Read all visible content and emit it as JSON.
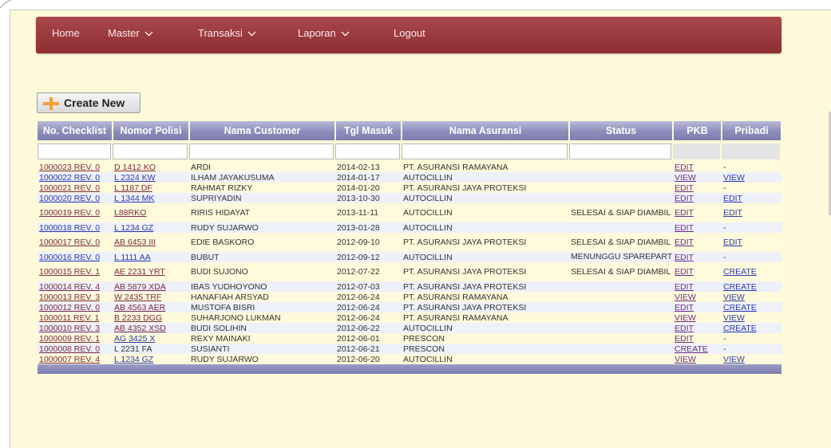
{
  "nav": {
    "items": [
      {
        "label": "Home",
        "dropdown": false
      },
      {
        "label": "Master",
        "dropdown": true
      },
      {
        "label": "Transaksi",
        "dropdown": true
      },
      {
        "label": "Laporan",
        "dropdown": true
      },
      {
        "label": "Logout",
        "dropdown": false
      }
    ]
  },
  "create_button": {
    "label": "Create New",
    "icon": "plus-icon"
  },
  "table": {
    "headers": [
      "No. Checklist",
      "Nomor Polisi",
      "Nama Customer",
      "Tgl Masuk",
      "Nama Asuransi",
      "Status",
      "PKB",
      "Pribadi"
    ],
    "rows": [
      {
        "checklist": "1000023 REV. 0",
        "polisi": "D 1412 KO",
        "customer": "ARDI",
        "tgl": "2014-02-13",
        "asuransi": "PT. ASURANSI RAMAYANA",
        "status": "",
        "pkb": "EDIT",
        "pribadi": "-"
      },
      {
        "checklist": "1000022 REV. 0",
        "polisi": "L 2324 KW",
        "customer": "ILHAM JAYAKUSUMA",
        "tgl": "2014-01-17",
        "asuransi": "AUTOCILLIN",
        "status": "",
        "pkb": "VIEW",
        "pribadi": "VIEW"
      },
      {
        "checklist": "1000021 REV. 0",
        "polisi": "L 1187 DF",
        "customer": "RAHMAT RIZKY",
        "tgl": "2014-01-20",
        "asuransi": "PT. ASURANSI JAYA PROTEKSI",
        "status": "",
        "pkb": "EDIT",
        "pribadi": "-"
      },
      {
        "checklist": "1000020 REV. 0",
        "polisi": "L 1344 MK",
        "customer": "SUPRIYADIN",
        "tgl": "2013-10-30",
        "asuransi": "AUTOCILLIN",
        "status": "",
        "pkb": "EDIT",
        "pribadi": "EDIT"
      },
      {
        "checklist": "1000019 REV. 0",
        "polisi": "L88RKO",
        "customer": "RIRIS HIDAYAT",
        "tgl": "2013-11-11",
        "asuransi": "AUTOCILLIN",
        "status": "SELESAI & SIAP DIAMBIL",
        "pkb": "EDIT",
        "pribadi": "EDIT"
      },
      {
        "checklist": "1000018 REV. 0",
        "polisi": "L 1234 GZ",
        "customer": "RUDY SUJARWO",
        "tgl": "2013-01-28",
        "asuransi": "AUTOCILLIN",
        "status": "",
        "pkb": "EDIT",
        "pribadi": "-"
      },
      {
        "checklist": "1000017 REV. 0",
        "polisi": "AB 6453 III",
        "customer": "EDIE BASKORO",
        "tgl": "2012-09-10",
        "asuransi": "PT. ASURANSI JAYA PROTEKSI",
        "status": "SELESAI & SIAP DIAMBIL",
        "pkb": "EDIT",
        "pribadi": "EDIT"
      },
      {
        "checklist": "1000016 REV. 0",
        "polisi": "L 1111 AA",
        "customer": "BUBUT",
        "tgl": "2012-09-12",
        "asuransi": "AUTOCILLIN",
        "status": "MENUNGGU SPAREPART",
        "pkb": "EDIT",
        "pribadi": "-"
      },
      {
        "checklist": "1000015 REV. 1",
        "polisi": "AE 2231 YRT",
        "customer": "BUDI SUJONO",
        "tgl": "2012-07-22",
        "asuransi": "PT. ASURANSI JAYA PROTEKSI",
        "status": "SELESAI & SIAP DIAMBIL",
        "pkb": "EDIT",
        "pribadi": "CREATE"
      },
      {
        "checklist": "1000014 REV. 4",
        "polisi": "AB 5879 XDA",
        "customer": "IBAS YUDHOYONO",
        "tgl": "2012-07-03",
        "asuransi": "PT. ASURANSI JAYA PROTEKSI",
        "status": "",
        "pkb": "EDIT",
        "pribadi": "CREATE"
      },
      {
        "checklist": "1000013 REV. 3",
        "polisi": "W 2435 TRF",
        "customer": "HANAFIAH ARSYAD",
        "tgl": "2012-06-24",
        "asuransi": "PT. ASURANSI RAMAYANA",
        "status": "",
        "pkb": "VIEW",
        "pribadi": "VIEW"
      },
      {
        "checklist": "1000012 REV. 0",
        "polisi": "AB 4563 AER",
        "customer": "MUSTOFA BISRI",
        "tgl": "2012-06-24",
        "asuransi": "PT. ASURANSI JAYA PROTEKSI",
        "status": "",
        "pkb": "EDIT",
        "pribadi": "CREATE"
      },
      {
        "checklist": "1000011 REV. 1",
        "polisi": "B 2233 DGG",
        "customer": "SUHARJONO LUKMAN",
        "tgl": "2012-06-24",
        "asuransi": "PT. ASURANSI RAMAYANA",
        "status": "",
        "pkb": "VIEW",
        "pribadi": "VIEW"
      },
      {
        "checklist": "1000010 REV. 3",
        "polisi": "AB 4352 XSD",
        "customer": "BUDI SOLIHIN",
        "tgl": "2012-06-22",
        "asuransi": "AUTOCILLIN",
        "status": "",
        "pkb": "EDIT",
        "pribadi": "CREATE"
      },
      {
        "checklist": "1000009 REV. 1",
        "polisi": "AG 3425 X",
        "customer": "REXY MAINAKI",
        "tgl": "2012-06-01",
        "asuransi": "PRESCON",
        "status": "",
        "pkb": "EDIT",
        "pribadi": "-"
      },
      {
        "checklist": "1000008 REV. 0",
        "polisi": "L 2231 FA",
        "customer": "SUSIANTI",
        "tgl": "2012-06-21",
        "asuransi": "PRESCON",
        "status": "",
        "pkb": "CREATE",
        "pribadi": "-"
      },
      {
        "checklist": "1000007 REV. 4",
        "polisi": "L 1234 GZ",
        "customer": "RUDY SUJARWO",
        "tgl": "2012-06-20",
        "asuransi": "AUTOCILLIN",
        "status": "",
        "pkb": "VIEW",
        "pribadi": "VIEW"
      }
    ]
  },
  "colors": {
    "navbar": "#9b3a3f",
    "page_bg": "#fefad9",
    "header_bg": "#8d8dbb",
    "link": "#7a2a40",
    "link_alt": "#2a3aa8"
  }
}
